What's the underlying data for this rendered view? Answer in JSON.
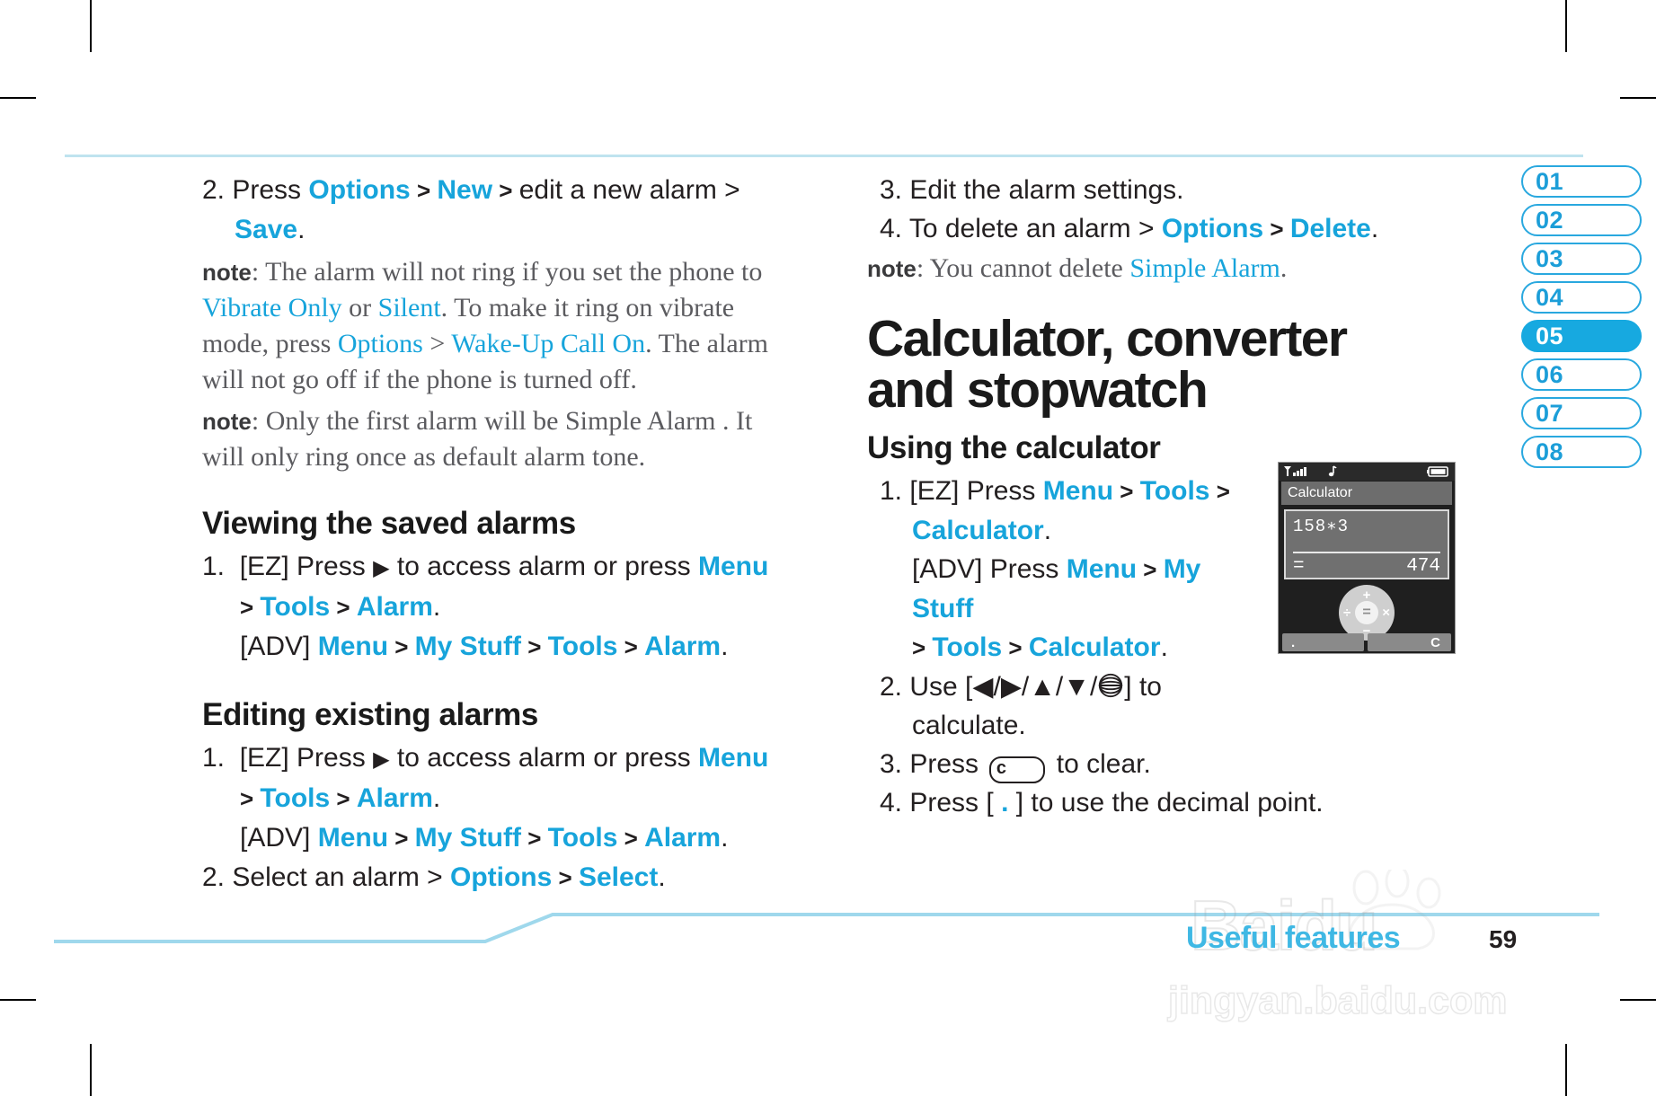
{
  "colors": {
    "accent": "#17a4db",
    "tab_active_bg": "#17a9e0",
    "rule": "#bfe3ef",
    "footer": "#3fb8e4"
  },
  "left_column": {
    "step2": {
      "num": "2.",
      "pre": "Press ",
      "k1": "Options",
      "sep1": " > ",
      "k2": "New",
      "sep2": " > ",
      "mid": "edit a new alarm > ",
      "k3": "Save",
      "end": "."
    },
    "note1": {
      "label": "note",
      "t1": ": The alarm will not ring if you set the phone to ",
      "c1": "Vibrate Only",
      "t2": " or ",
      "c2": "Silent",
      "t3": ". To make it ring on vibrate mode, press ",
      "c3": "Options",
      "t4": " > ",
      "c4": "Wake-Up Call On",
      "t5": ". The alarm will not go off if the phone is turned off."
    },
    "note2": {
      "label": "note",
      "text": ": Only the first alarm will be Simple Alarm . It will only ring once as default alarm tone."
    },
    "heading_viewing": "Viewing the saved alarms",
    "viewing_steps": {
      "num": "1.",
      "ez_pre": "[EZ] Press ",
      "arrow": "▶",
      "ez_mid": " to access alarm or press ",
      "k_menu": "Menu",
      "line2_pre": "> ",
      "k_tools": "Tools",
      "line2_sep": " > ",
      "k_alarm": "Alarm",
      "line2_end": ".",
      "adv_label": "[ADV] ",
      "adv_menu": "Menu",
      "adv_s1": " > ",
      "adv_mystuff": "My Stuff",
      "adv_s2": " > ",
      "adv_tools": "Tools",
      "adv_s3": " > ",
      "adv_alarm": "Alarm",
      "adv_end": "."
    },
    "heading_editing": "Editing existing alarms",
    "editing_step2": {
      "num": "2.",
      "pre": "Select an alarm > ",
      "k1": "Options",
      "sep": " > ",
      "k2": "Select",
      "end": "."
    }
  },
  "right_column": {
    "step3": {
      "num": "3.",
      "text": "Edit the alarm settings."
    },
    "step4": {
      "num": "4.",
      "pre": "To delete an alarm > ",
      "k1": "Options",
      "sep": " > ",
      "k2": "Delete",
      "end": "."
    },
    "note3": {
      "label": "note",
      "t1": ": You cannot delete ",
      "c1": "Simple Alarm",
      "t2": "."
    },
    "chapter_title_line1": "Calculator, converter",
    "chapter_title_line2": "and stopwatch",
    "heading_using": "Using the calculator",
    "calc_steps": {
      "s1_num": "1.",
      "s1_ez": "[EZ] Press ",
      "s1_menu": "Menu",
      "s1_sep1": " > ",
      "s1_tools": "Tools",
      "s1_sep2": " > ",
      "s1_calc": "Calculator",
      "s1_end": ".",
      "s1_adv": "[ADV] Press ",
      "s1_adv_menu": "Menu",
      "s1_adv_sep1": " > ",
      "s1_adv_mystuff": "My Stuff",
      "s1_adv_l2_sep": "> ",
      "s1_adv_tools": "Tools",
      "s1_adv_sep3": " > ",
      "s1_adv_calc": "Calculator",
      "s1_adv_end": ".",
      "s2_num": "2.",
      "s2_pre": "Use [",
      "s2_keys": "◀/▶/▲/▼/",
      "s2_post": "] to",
      "s2_cont": "calculate.",
      "s3_num": "3.",
      "s3_pre": "Press ",
      "s3_key": "c",
      "s3_post": " to clear.",
      "s4_num": "4.",
      "s4_pre": "Press [ ",
      "s4_dot": ".",
      "s4_post": " ] to use the decimal point."
    }
  },
  "phone": {
    "status_icons": [
      "signal-icon",
      "music-note-icon",
      "battery-icon"
    ],
    "title": "Calculator",
    "expression": "158∗3",
    "equals_sign": "=",
    "result": "474",
    "keypad": {
      "up": "+",
      "down": "−",
      "left": "÷",
      "right": "×",
      "center": "="
    },
    "softkey_left": ".",
    "softkey_right": "C"
  },
  "tabs": [
    {
      "label": "01",
      "active": false
    },
    {
      "label": "02",
      "active": false
    },
    {
      "label": "03",
      "active": false
    },
    {
      "label": "04",
      "active": false
    },
    {
      "label": "05",
      "active": true
    },
    {
      "label": "06",
      "active": false
    },
    {
      "label": "07",
      "active": false
    },
    {
      "label": "08",
      "active": false
    }
  ],
  "footer": {
    "section": "Useful features",
    "page_number": "59",
    "watermark_main": "Baidu",
    "watermark_url": "jingyan.baidu.com"
  }
}
